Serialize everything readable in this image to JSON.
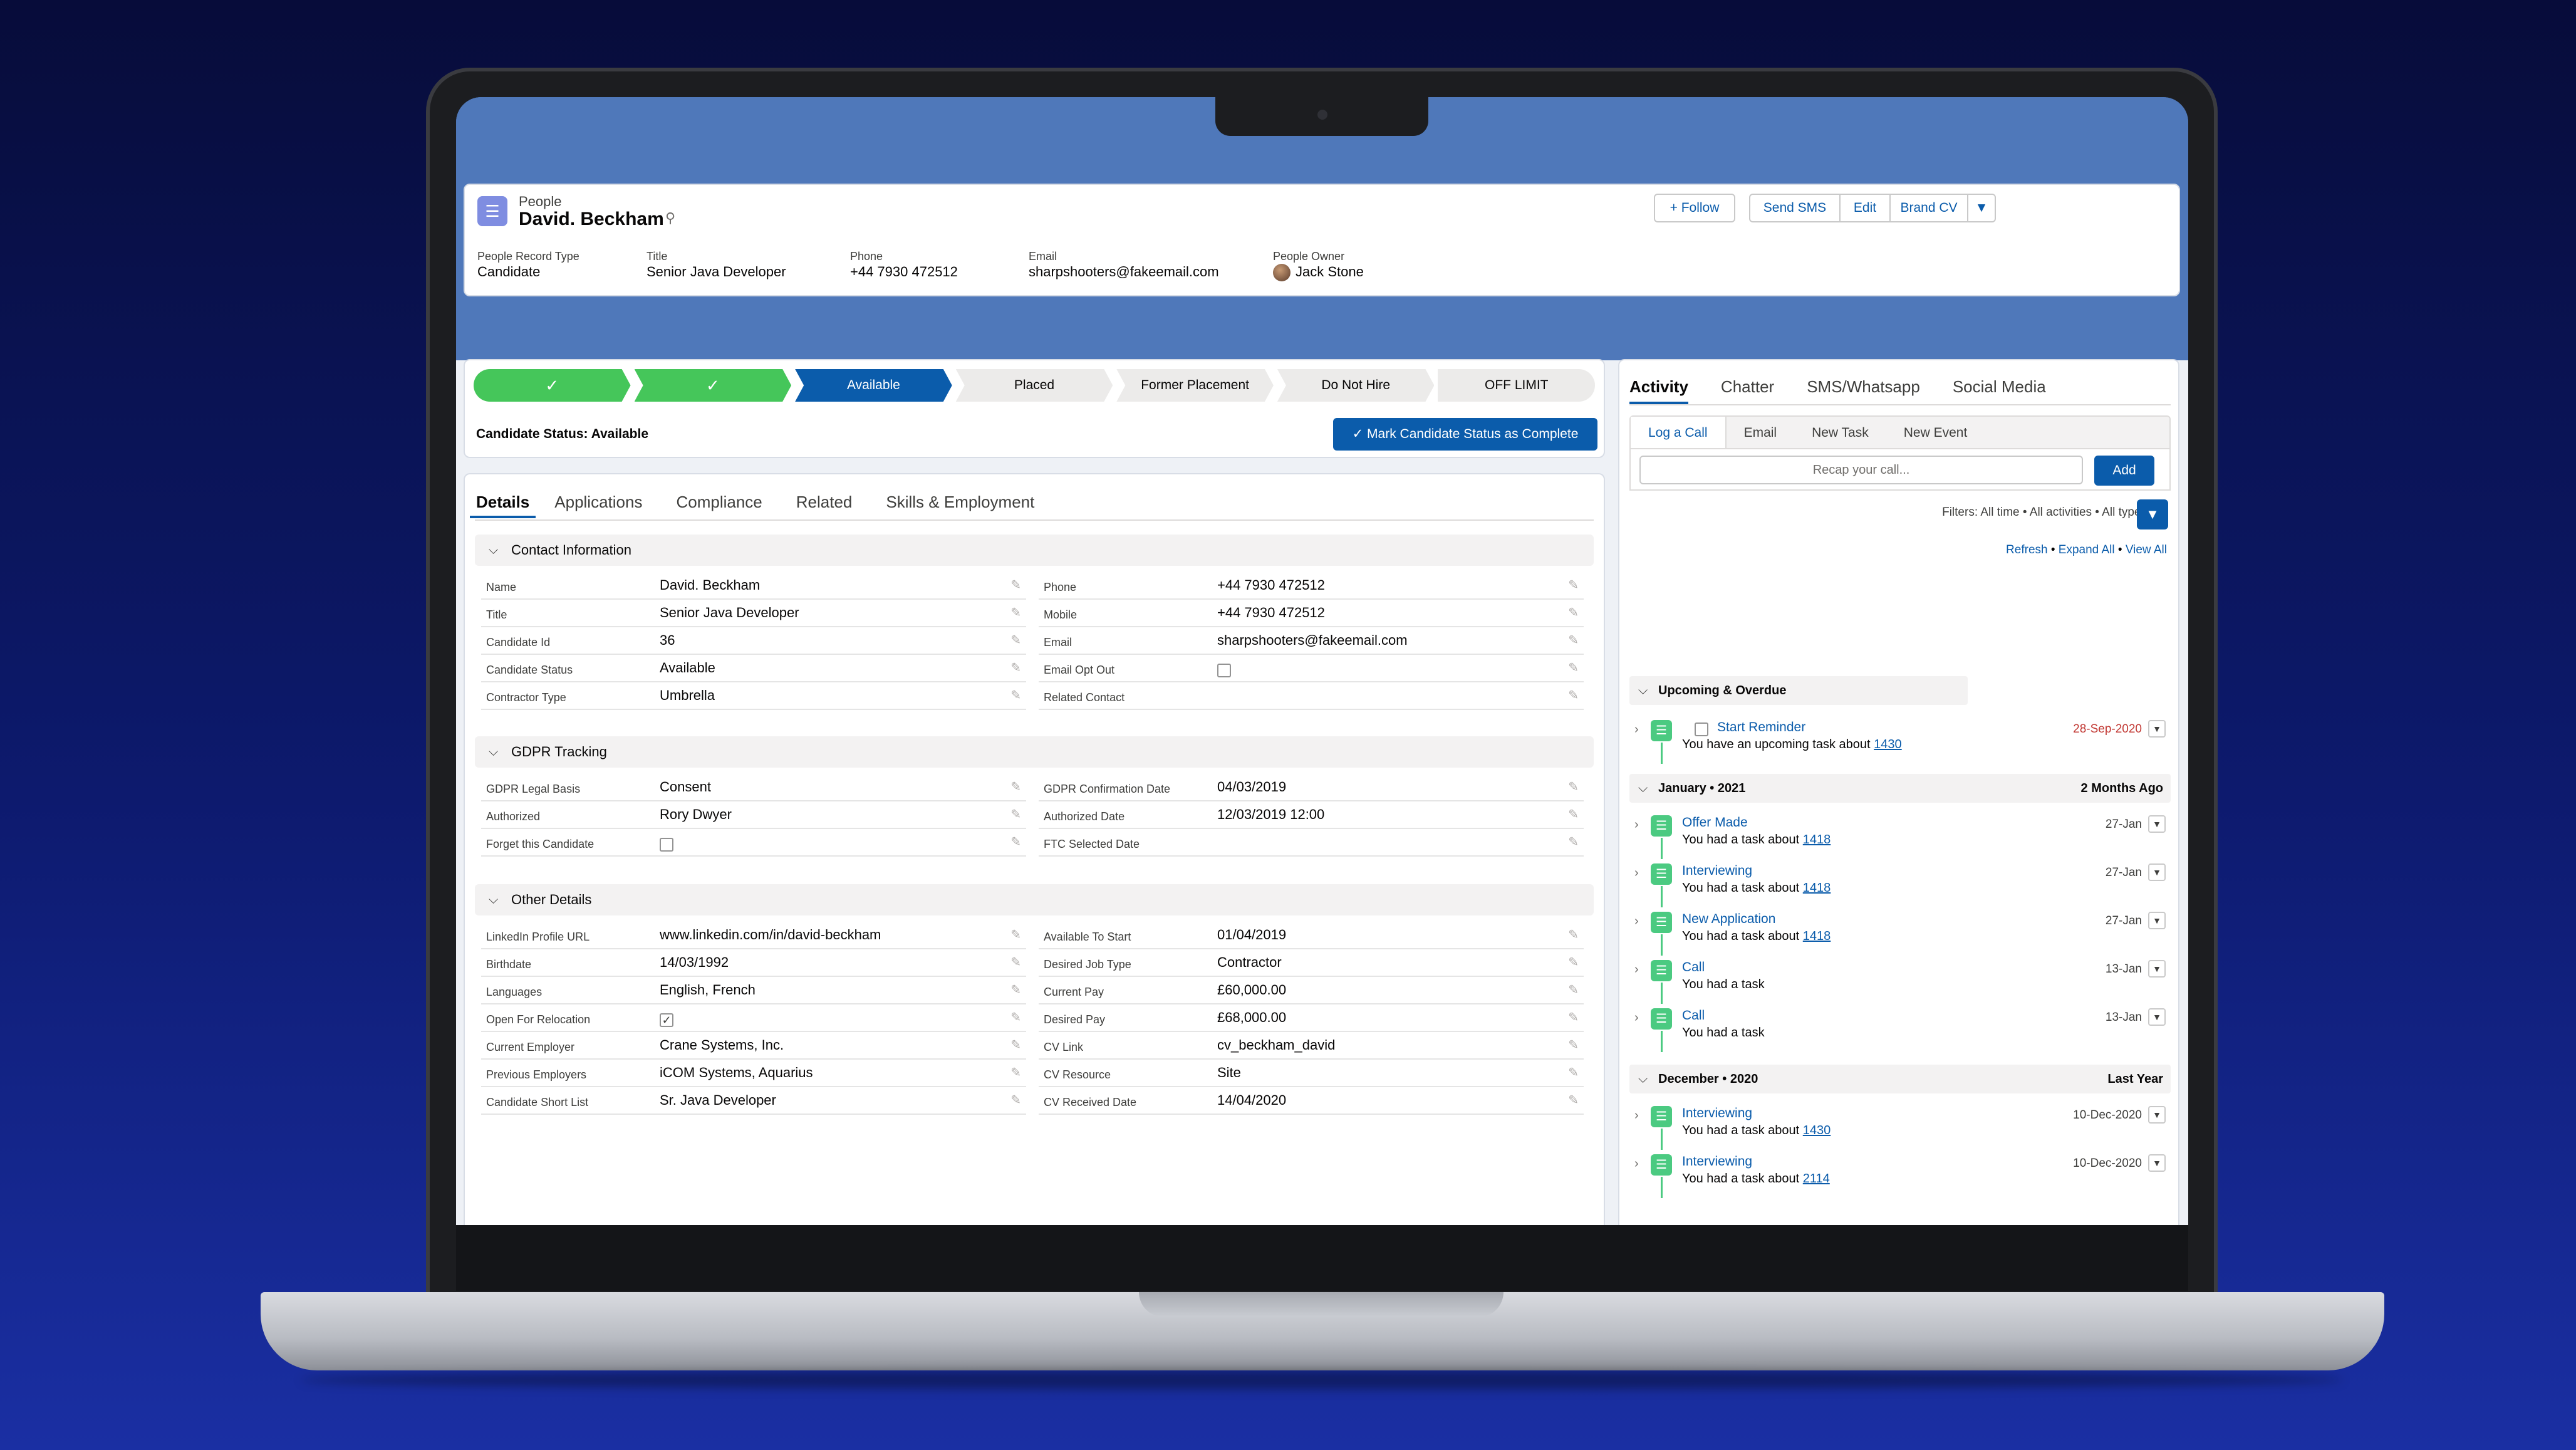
{
  "header": {
    "object_label": "People",
    "record_name": "David. Beckham",
    "buttons": {
      "follow": "Follow",
      "send_sms": "Send SMS",
      "edit": "Edit",
      "brand_cv": "Brand CV"
    },
    "fields": [
      {
        "label": "People Record Type",
        "value": "Candidate"
      },
      {
        "label": "Title",
        "value": "Senior Java Developer"
      },
      {
        "label": "Phone",
        "value": "+44 7930 472512"
      },
      {
        "label": "Email",
        "value": "sharpshooters@fakeemail.com"
      },
      {
        "label": "People Owner",
        "value": "Jack Stone"
      }
    ]
  },
  "path": {
    "steps": [
      "✓",
      "✓",
      "Available",
      "Placed",
      "Former Placement",
      "Do Not Hire",
      "OFF LIMIT"
    ],
    "status_text": "Candidate Status: Available",
    "complete_button": "Mark Candidate Status as Complete"
  },
  "details": {
    "tabs": [
      "Details",
      "Applications",
      "Compliance",
      "Related",
      "Skills & Employment"
    ],
    "sections": {
      "contact": "Contact Information",
      "gdpr": "GDPR Tracking",
      "other": "Other Details"
    },
    "contact_left": [
      {
        "label": "Name",
        "value": "David. Beckham"
      },
      {
        "label": "Title",
        "value": "Senior Java Developer"
      },
      {
        "label": "Candidate Id",
        "value": "36"
      },
      {
        "label": "Candidate Status",
        "value": "Available"
      },
      {
        "label": "Contractor Type",
        "value": "Umbrella"
      }
    ],
    "contact_right": [
      {
        "label": "Phone",
        "value": "+44 7930 472512"
      },
      {
        "label": "Mobile",
        "value": "+44 7930 472512"
      },
      {
        "label": "Email",
        "value": "sharpshooters@fakeemail.com"
      },
      {
        "label": "Email Opt Out",
        "value": ""
      },
      {
        "label": "Related Contact",
        "value": ""
      }
    ],
    "gdpr_left": [
      {
        "label": "GDPR Legal Basis",
        "value": "Consent"
      },
      {
        "label": "Authorized",
        "value": "Rory Dwyer"
      },
      {
        "label": "Forget this Candidate",
        "value": ""
      }
    ],
    "gdpr_right": [
      {
        "label": "GDPR Confirmation Date",
        "value": "04/03/2019"
      },
      {
        "label": "Authorized Date",
        "value": "12/03/2019 12:00"
      },
      {
        "label": "FTC Selected Date",
        "value": ""
      }
    ],
    "other_left": [
      {
        "label": "LinkedIn Profile URL",
        "value": "www.linkedin.com/in/david-beckham"
      },
      {
        "label": "Birthdate",
        "value": "14/03/1992"
      },
      {
        "label": "Languages",
        "value": "English, French"
      },
      {
        "label": "Open For Relocation",
        "value": "✓"
      },
      {
        "label": "Current Employer",
        "value": "Crane Systems, Inc."
      },
      {
        "label": "Previous Employers",
        "value": "iCOM Systems, Aquarius"
      },
      {
        "label": "Candidate Short List",
        "value": "Sr. Java Developer"
      }
    ],
    "other_right": [
      {
        "label": "Available To Start",
        "value": "01/04/2019"
      },
      {
        "label": "Desired Job Type",
        "value": "Contractor"
      },
      {
        "label": "Current Pay",
        "value": "£60,000.00"
      },
      {
        "label": "Desired Pay",
        "value": "£68,000.00"
      },
      {
        "label": "CV Link",
        "value": "cv_beckham_david"
      },
      {
        "label": "CV Resource",
        "value": "Site"
      },
      {
        "label": "CV Received Date",
        "value": "14/04/2020"
      }
    ]
  },
  "activity": {
    "tabs": [
      "Activity",
      "Chatter",
      "SMS/Whatsapp",
      "Social Media"
    ],
    "publisher_tabs": [
      "Log a Call",
      "Email",
      "New Task",
      "New Event"
    ],
    "recap_placeholder": "Recap your call...",
    "add_button": "Add",
    "filters": "Filters: All time • All activities • All types",
    "links": {
      "refresh": "Refresh",
      "expand_all": "Expand All",
      "view_all": "View All"
    },
    "groups": {
      "upcoming": {
        "label": "Upcoming & Overdue"
      },
      "jan": {
        "label": "January • 2021",
        "right": "2 Months Ago"
      },
      "dec": {
        "label": "December • 2020",
        "right": "Last Year"
      }
    },
    "upcoming_item": {
      "title": "Start Reminder",
      "sub": "You have an upcoming task about",
      "ref": "1430",
      "date": "28-Sep-2020"
    },
    "jan_items": [
      {
        "title": "Offer Made",
        "sub": "You had a task about",
        "ref": "1418",
        "date": "27-Jan"
      },
      {
        "title": "Interviewing",
        "sub": "You had a task about",
        "ref": "1418",
        "date": "27-Jan"
      },
      {
        "title": "New Application",
        "sub": "You had a task about",
        "ref": "1418",
        "date": "27-Jan"
      },
      {
        "title": "Call",
        "sub": "You had a task",
        "ref": "",
        "date": "13-Jan"
      },
      {
        "title": "Call",
        "sub": "You had a task",
        "ref": "",
        "date": "13-Jan"
      }
    ],
    "dec_items": [
      {
        "title": "Interviewing",
        "sub": "You had a task about",
        "ref": "1430",
        "date": "10-Dec-2020"
      },
      {
        "title": "Interviewing",
        "sub": "You had a task about",
        "ref": "2114",
        "date": "10-Dec-2020"
      }
    ]
  }
}
